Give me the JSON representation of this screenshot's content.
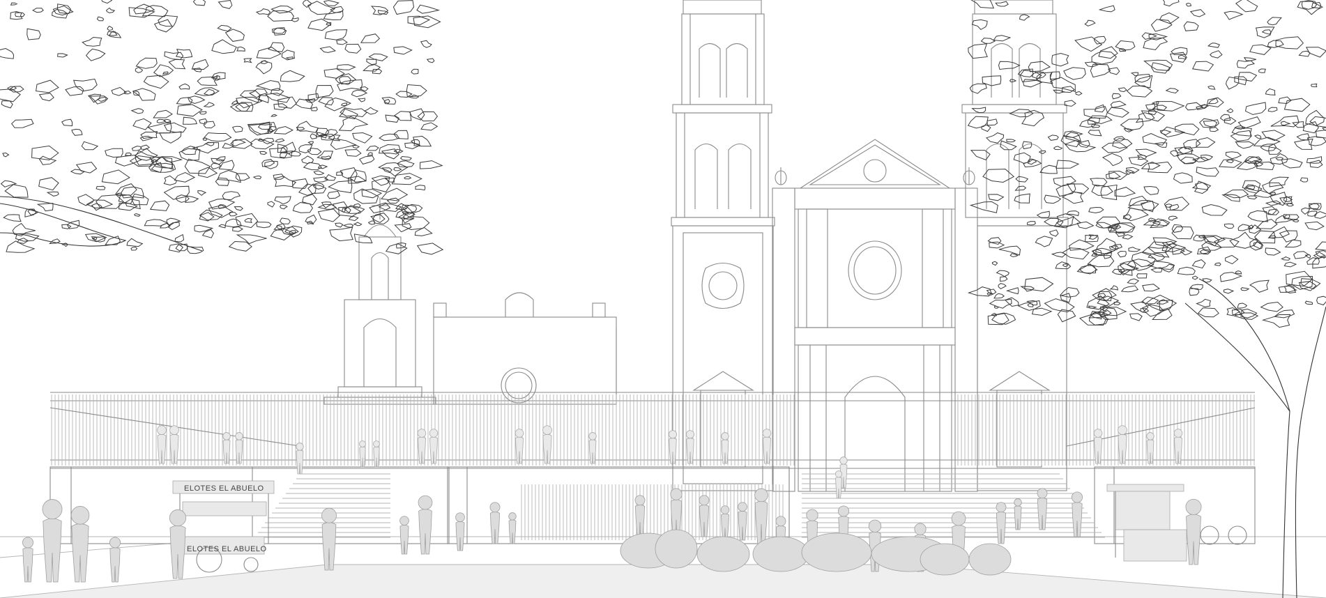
{
  "scene": {
    "cart_left_sign_top": "ELOTES EL ABUELO",
    "cart_left_sign_bottom": "ELOTES EL ABUELO",
    "colors": {
      "background": "#ffffff",
      "line": "#8a8a8a",
      "foliage": "#3a3a3a",
      "figure_fill": "#e6e6e6"
    }
  }
}
